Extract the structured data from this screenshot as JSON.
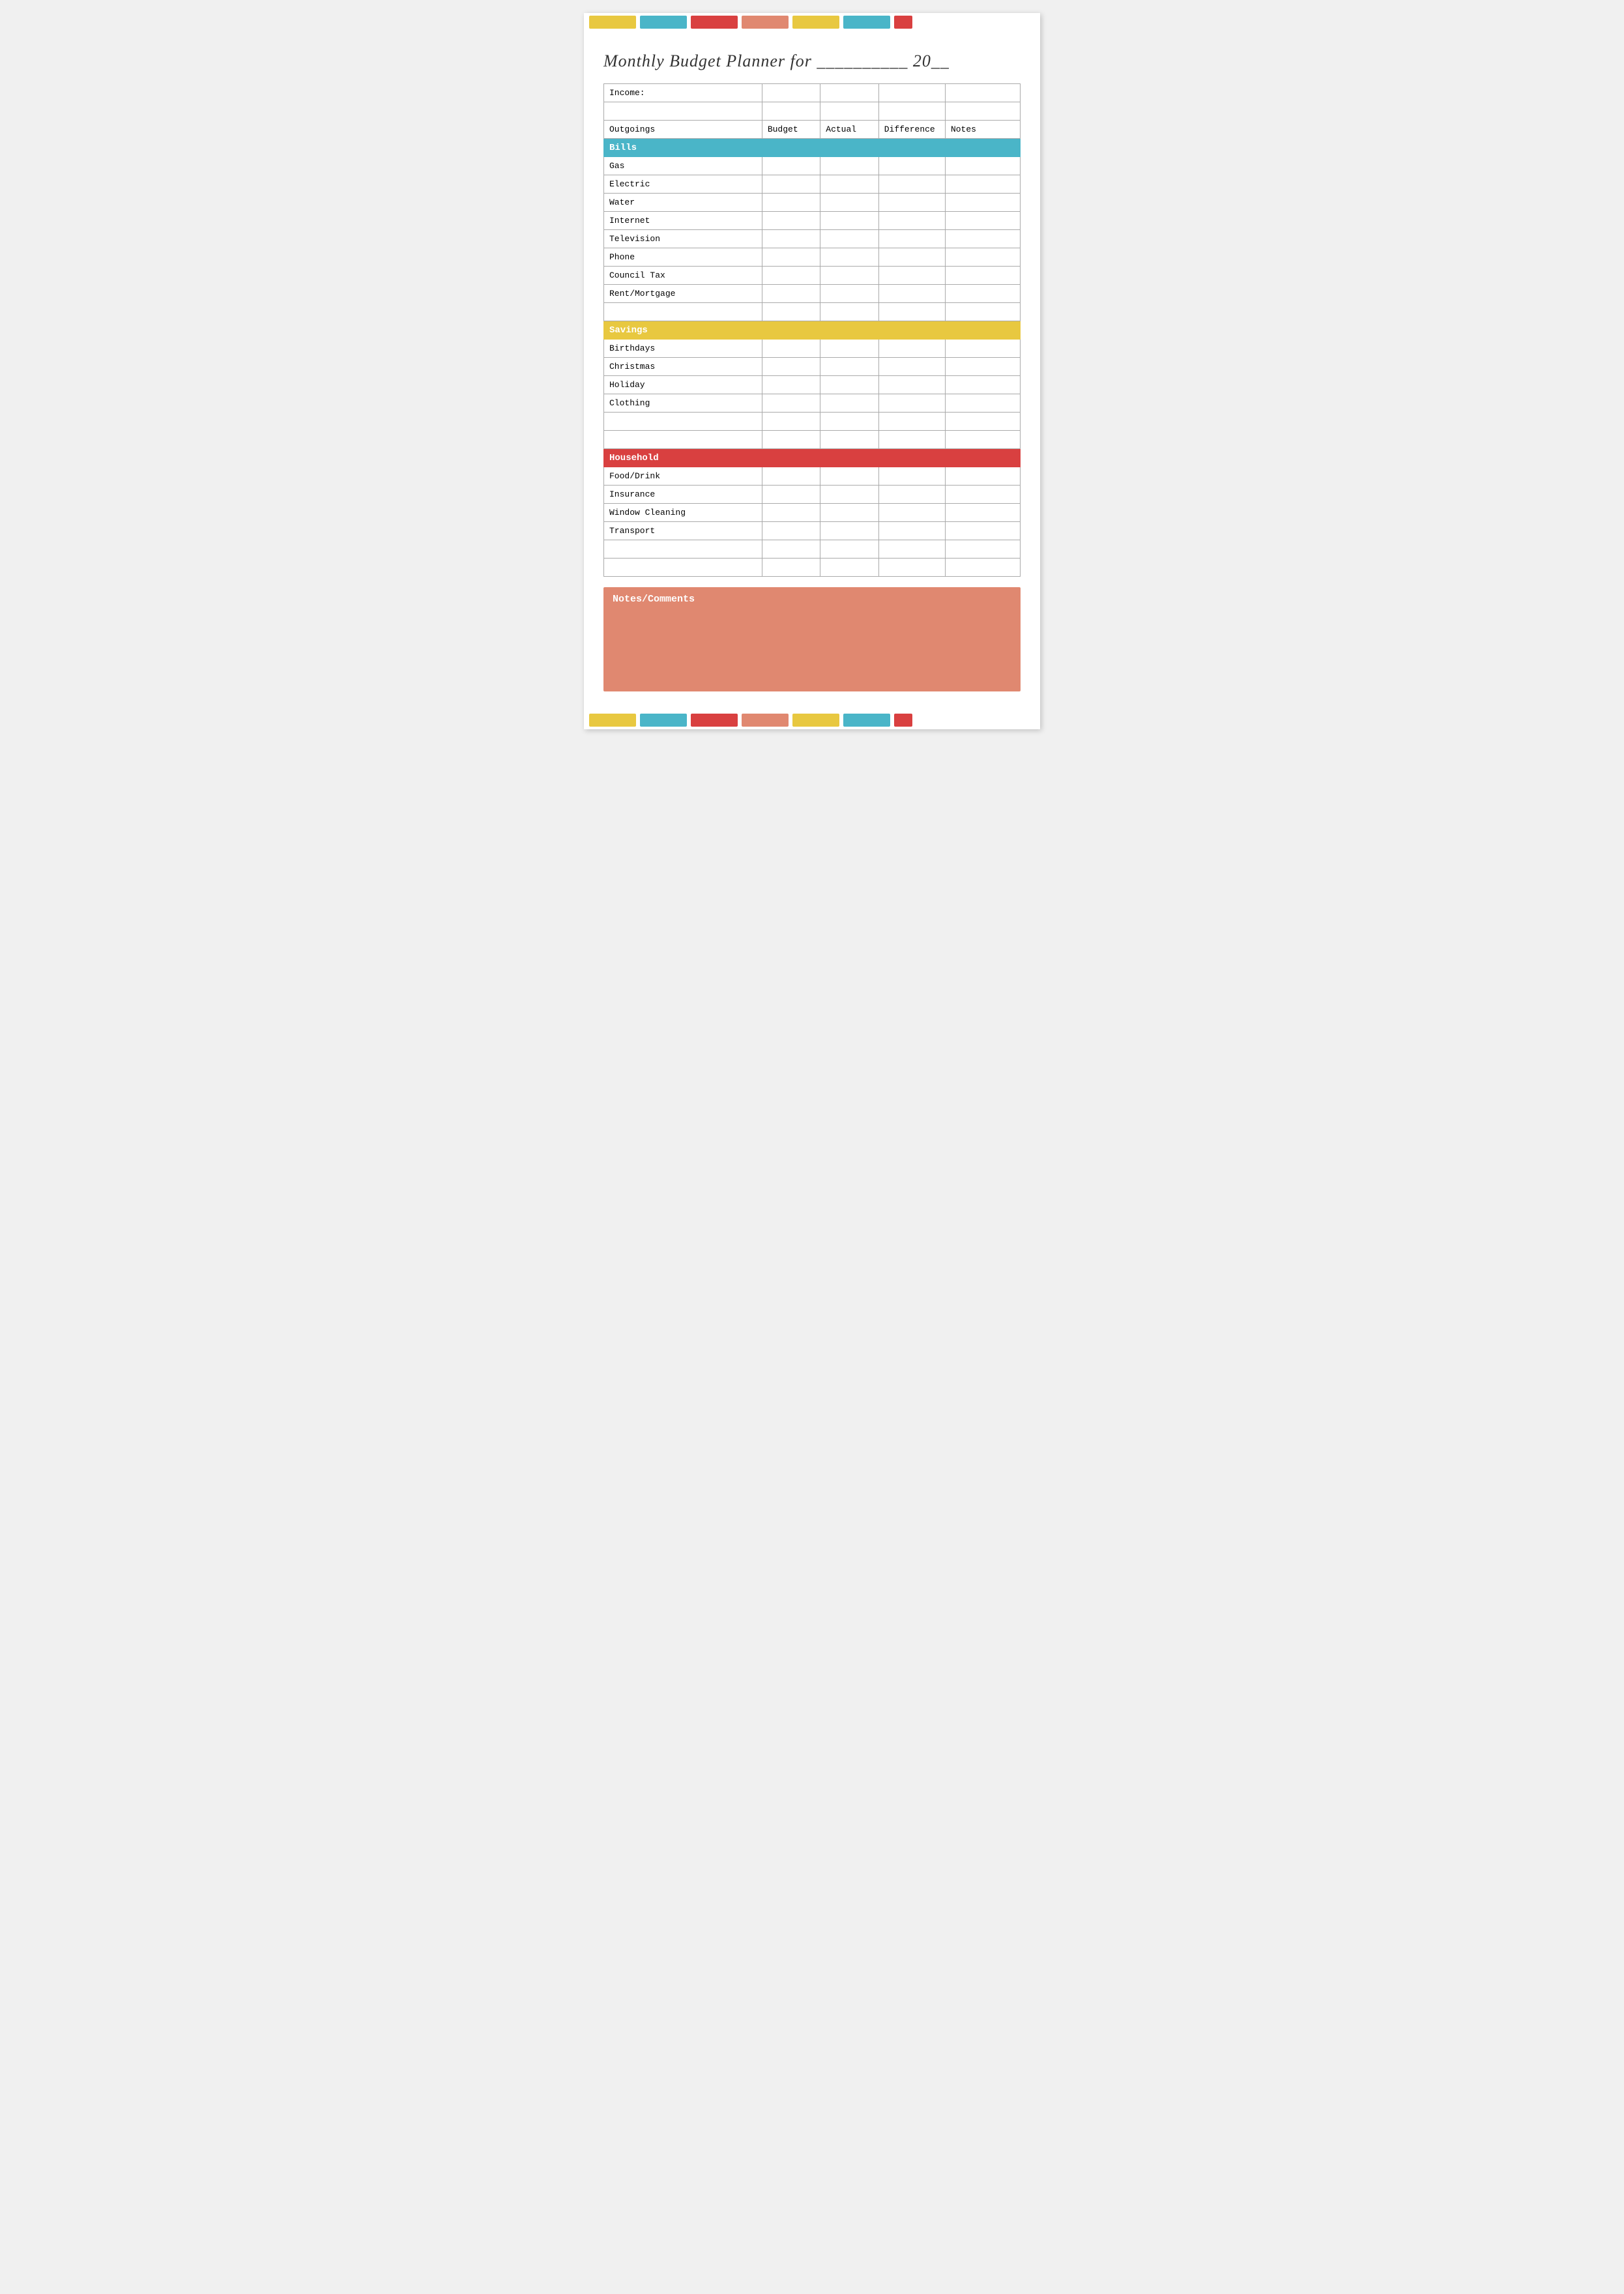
{
  "page": {
    "title": "Monthly Budget Planner for __________ 20__"
  },
  "colorBar": {
    "swatches": [
      "yellow",
      "teal",
      "red",
      "salmon",
      "yellow",
      "teal",
      "red-small"
    ]
  },
  "incomeRow": {
    "label": "Income:"
  },
  "outgoingsHeaders": {
    "label": "Outgoings",
    "budget": "Budget",
    "actual": "Actual",
    "difference": "Difference",
    "notes": "Notes"
  },
  "sections": {
    "bills": {
      "label": "Bills",
      "items": [
        "Gas",
        "Electric",
        "Water",
        "Internet",
        "Television",
        "Phone",
        "Council Tax",
        "Rent/Mortgage"
      ]
    },
    "savings": {
      "label": "Savings",
      "items": [
        "Birthdays",
        "Christmas",
        "Holiday",
        "Clothing"
      ]
    },
    "household": {
      "label": "Household",
      "items": [
        "Food/Drink",
        "Insurance",
        "Window Cleaning",
        "Transport"
      ]
    }
  },
  "notesSection": {
    "label": "Notes/Comments"
  }
}
